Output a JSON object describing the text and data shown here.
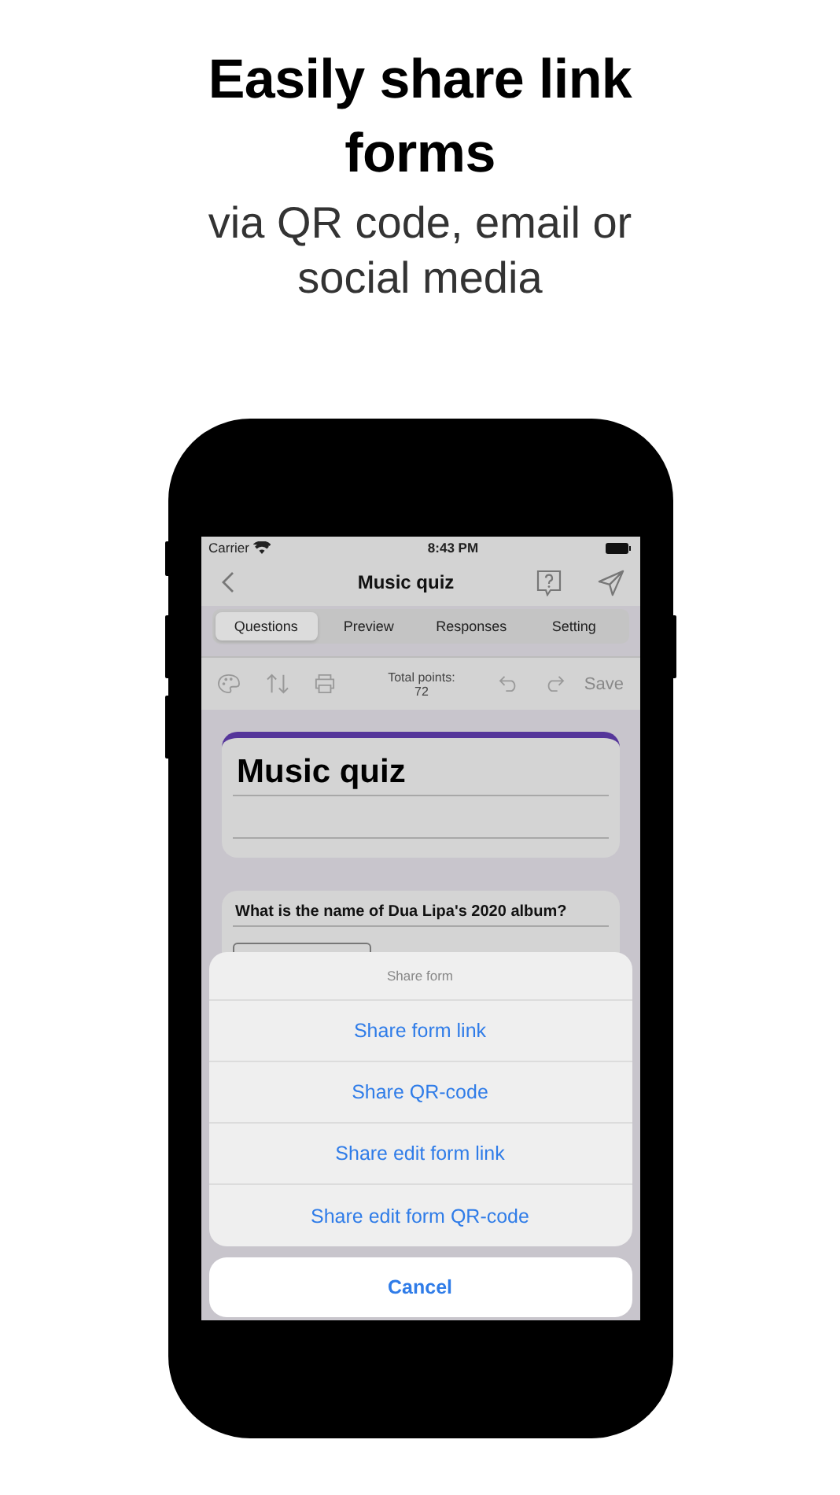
{
  "headline": "Easily share link forms",
  "subheadline": "via QR code, email or social media",
  "status_bar": {
    "carrier": "Carrier",
    "time": "8:43 PM"
  },
  "nav": {
    "title": "Music quiz"
  },
  "tabs": [
    {
      "label": "Questions",
      "selected": true
    },
    {
      "label": "Preview",
      "selected": false
    },
    {
      "label": "Responses",
      "selected": false
    },
    {
      "label": "Setting",
      "selected": false
    }
  ],
  "toolbar": {
    "total_points_label": "Total points:",
    "total_points": "72",
    "save": "Save"
  },
  "form": {
    "title": "Music quiz"
  },
  "question": {
    "text": "What is the name of Dua Lipa's 2020 album?"
  },
  "action_sheet": {
    "title": "Share form",
    "actions": [
      "Share form link",
      "Share QR-code",
      "Share edit form link",
      "Share edit form QR-code"
    ],
    "cancel": "Cancel"
  }
}
